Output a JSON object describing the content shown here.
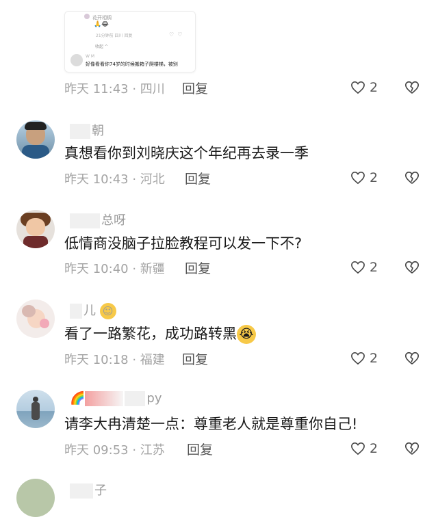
{
  "embed": {
    "name": "花开相稠",
    "emoji": "🙏😂",
    "meta": "21分钟前   四川   回复",
    "expand": "收起 ^",
    "user": "W M",
    "text": "好像看看你74岁的时候搬箱子爬楼梯，被别"
  },
  "top_row": {
    "time": "昨天 11:43 · 四川",
    "reply": "回复",
    "likes": "2"
  },
  "comments": [
    {
      "user": "朝",
      "text": "真想看你到刘晓庆这个年纪再去录一季",
      "time": "昨天 10:43 · 河北",
      "reply": "回复",
      "likes": "2"
    },
    {
      "user": "总呀",
      "text": "低情商没脑子拉脸教程可以发一下不?",
      "time": "昨天 10:40 · 新疆",
      "reply": "回复",
      "likes": "2"
    },
    {
      "user": "儿",
      "user_emoji": "☺",
      "text": "看了一路繁花，成功路转黑",
      "text_emoji": "😭",
      "time": "昨天 10:18 · 福建",
      "reply": "回复",
      "likes": "2"
    },
    {
      "user": "py",
      "user_emoji": "🌈",
      "text": "请李大冉清楚一点：尊重老人就是尊重你自己!",
      "time": "昨天 09:53 · 江苏",
      "reply": "回复",
      "likes": "2"
    },
    {
      "user": "子"
    }
  ],
  "icons": {
    "like": "heart-outline-icon",
    "dislike": "broken-heart-icon"
  }
}
